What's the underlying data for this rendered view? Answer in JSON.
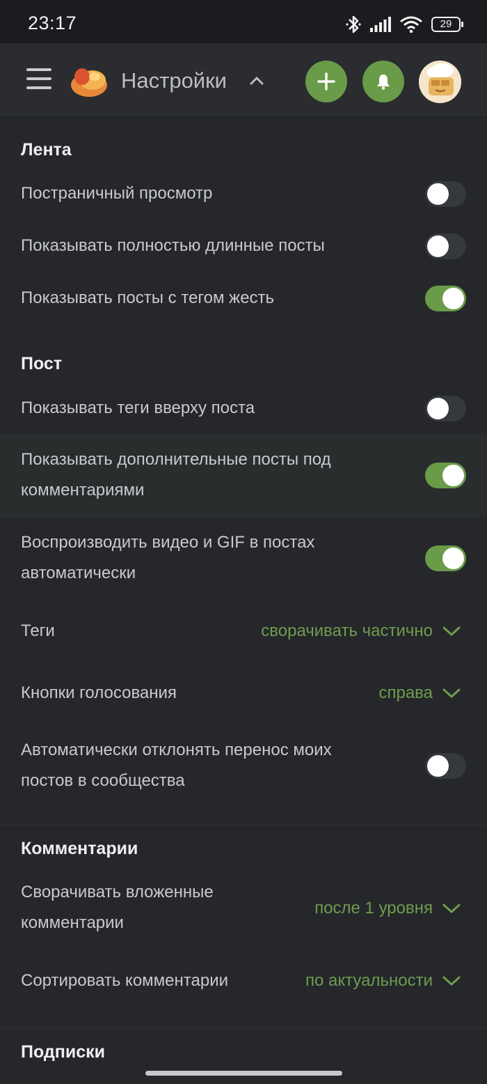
{
  "status_bar": {
    "time": "23:17",
    "battery": "29"
  },
  "app_bar": {
    "title": "Настройки"
  },
  "sections": {
    "feed": {
      "title": "Лента",
      "paged_view": "Постраничный просмотр",
      "long_posts": "Показывать полностью длинные посты",
      "gore_tag": "Показывать посты с тегом жесть"
    },
    "post": {
      "title": "Пост",
      "tags_top": "Показывать теги вверху поста",
      "extra_posts_1": "Показывать дополнительные посты под",
      "extra_posts_2": "комментариями",
      "autoplay_1": "Воспроизводить видео и GIF в постах",
      "autoplay_2": "автоматически",
      "tags_label": "Теги",
      "tags_value": "сворачивать частично",
      "vote_label": "Кнопки голосования",
      "vote_value": "справа",
      "decline_1": "Автоматически отклонять перенос моих",
      "decline_2": "постов в сообщества"
    },
    "comments": {
      "title": "Комментарии",
      "collapse_1": "Сворачивать вложенные",
      "collapse_2": "комментарии",
      "collapse_value": "после 1 уровня",
      "sort_label": "Сортировать комментарии",
      "sort_value": "по актуальности"
    },
    "subscriptions": {
      "title": "Подписки"
    }
  },
  "toggles": {
    "paged_view": false,
    "long_posts": false,
    "gore_tag": true,
    "tags_top": false,
    "extra_posts": true,
    "autoplay": true,
    "decline_transfer": false
  },
  "colors": {
    "accent": "#6a9b49",
    "background": "#25272b",
    "appbar": "#2a2c30"
  },
  "icons": [
    "menu-icon",
    "logo-icon",
    "chevron-up-icon",
    "plus-icon",
    "bell-icon",
    "avatar",
    "chevron-down-icon",
    "bluetooth-icon",
    "signal-icon",
    "wifi-icon",
    "battery-icon"
  ]
}
